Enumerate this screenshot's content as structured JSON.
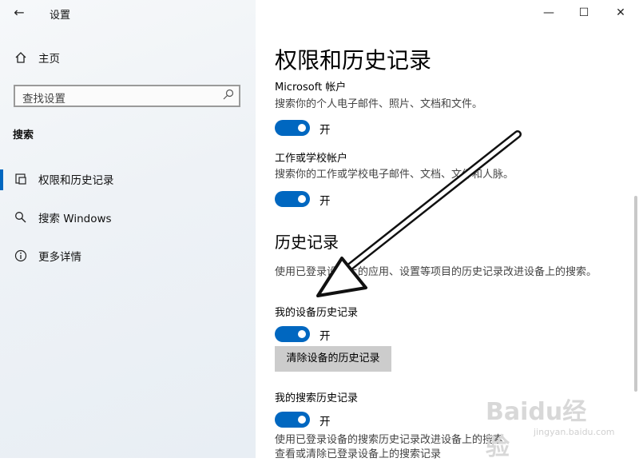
{
  "window": {
    "title": "设置",
    "back_icon": "←",
    "minimize": "—",
    "maximize": "☐",
    "close": "✕"
  },
  "sidebar": {
    "home_label": "主页",
    "search_placeholder": "查找设置",
    "section_title": "搜索",
    "items": [
      {
        "label": "权限和历史记录",
        "icon": "permissions-icon",
        "active": true
      },
      {
        "label": "搜索 Windows",
        "icon": "search-icon",
        "active": false
      },
      {
        "label": "更多详情",
        "icon": "info-icon",
        "active": false
      }
    ]
  },
  "main": {
    "title": "权限和历史记录",
    "microsoft_account": {
      "label": "Microsoft 帐户",
      "desc": "搜索你的个人电子邮件、照片、文档和文件。",
      "toggle_state": "开"
    },
    "work_account": {
      "label": "工作或学校帐户",
      "desc": "搜索你的工作或学校电子邮件、文档、文件和人脉。",
      "toggle_state": "开"
    },
    "history_heading": "历史记录",
    "history_desc": "使用已登录设备上的应用、设置等项目的历史记录改进设备上的搜索。",
    "device_history": {
      "label": "我的设备历史记录",
      "toggle_state": "开",
      "clear_button": "清除设备的历史记录"
    },
    "search_history": {
      "label": "我的搜索历史记录",
      "toggle_state": "开",
      "desc_line1": "使用已登录设备的搜索历史记录改进设备上的搜索",
      "desc_line2": "查看或清除已登录设备上的搜索记录"
    }
  },
  "watermark": {
    "text": "Baidu经验",
    "sub": "jingyan.baidu.com"
  },
  "colors": {
    "accent": "#0067c0",
    "button": "#cccccc"
  }
}
